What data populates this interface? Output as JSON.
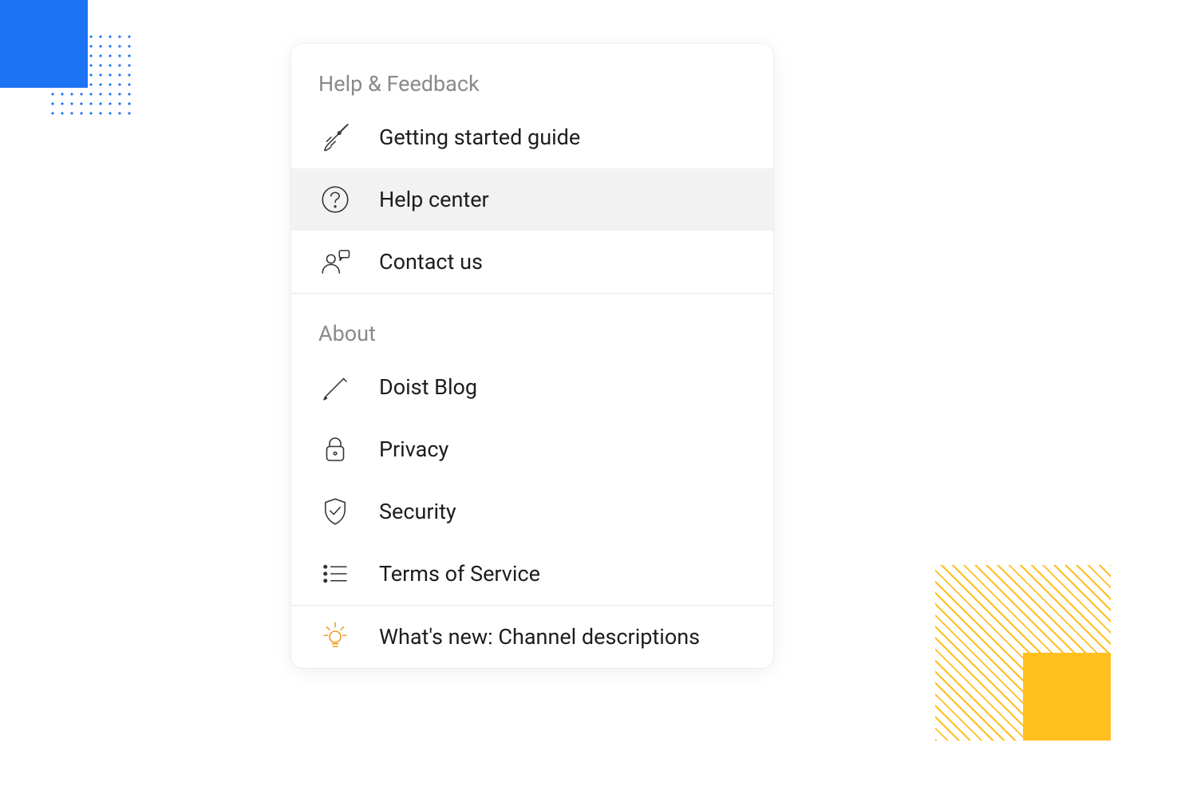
{
  "menu": {
    "sections": [
      {
        "title": "Help & Feedback",
        "items": [
          {
            "label": "Getting started guide",
            "icon": "rocket-icon",
            "highlighted": false
          },
          {
            "label": "Help center",
            "icon": "question-circle-icon",
            "highlighted": true
          },
          {
            "label": "Contact us",
            "icon": "person-chat-icon",
            "highlighted": false
          }
        ]
      },
      {
        "title": "About",
        "items": [
          {
            "label": "Doist Blog",
            "icon": "pencil-icon",
            "highlighted": false
          },
          {
            "label": "Privacy",
            "icon": "lock-icon",
            "highlighted": false
          },
          {
            "label": "Security",
            "icon": "shield-check-icon",
            "highlighted": false
          },
          {
            "label": "Terms of Service",
            "icon": "list-icon",
            "highlighted": false
          }
        ]
      }
    ],
    "footer_item": {
      "label": "What's new: Channel descriptions",
      "icon": "lightbulb-icon",
      "accent": "orange"
    }
  },
  "decorative_colors": {
    "blue": "#1b73f4",
    "yellow": "#ffbf1f"
  }
}
